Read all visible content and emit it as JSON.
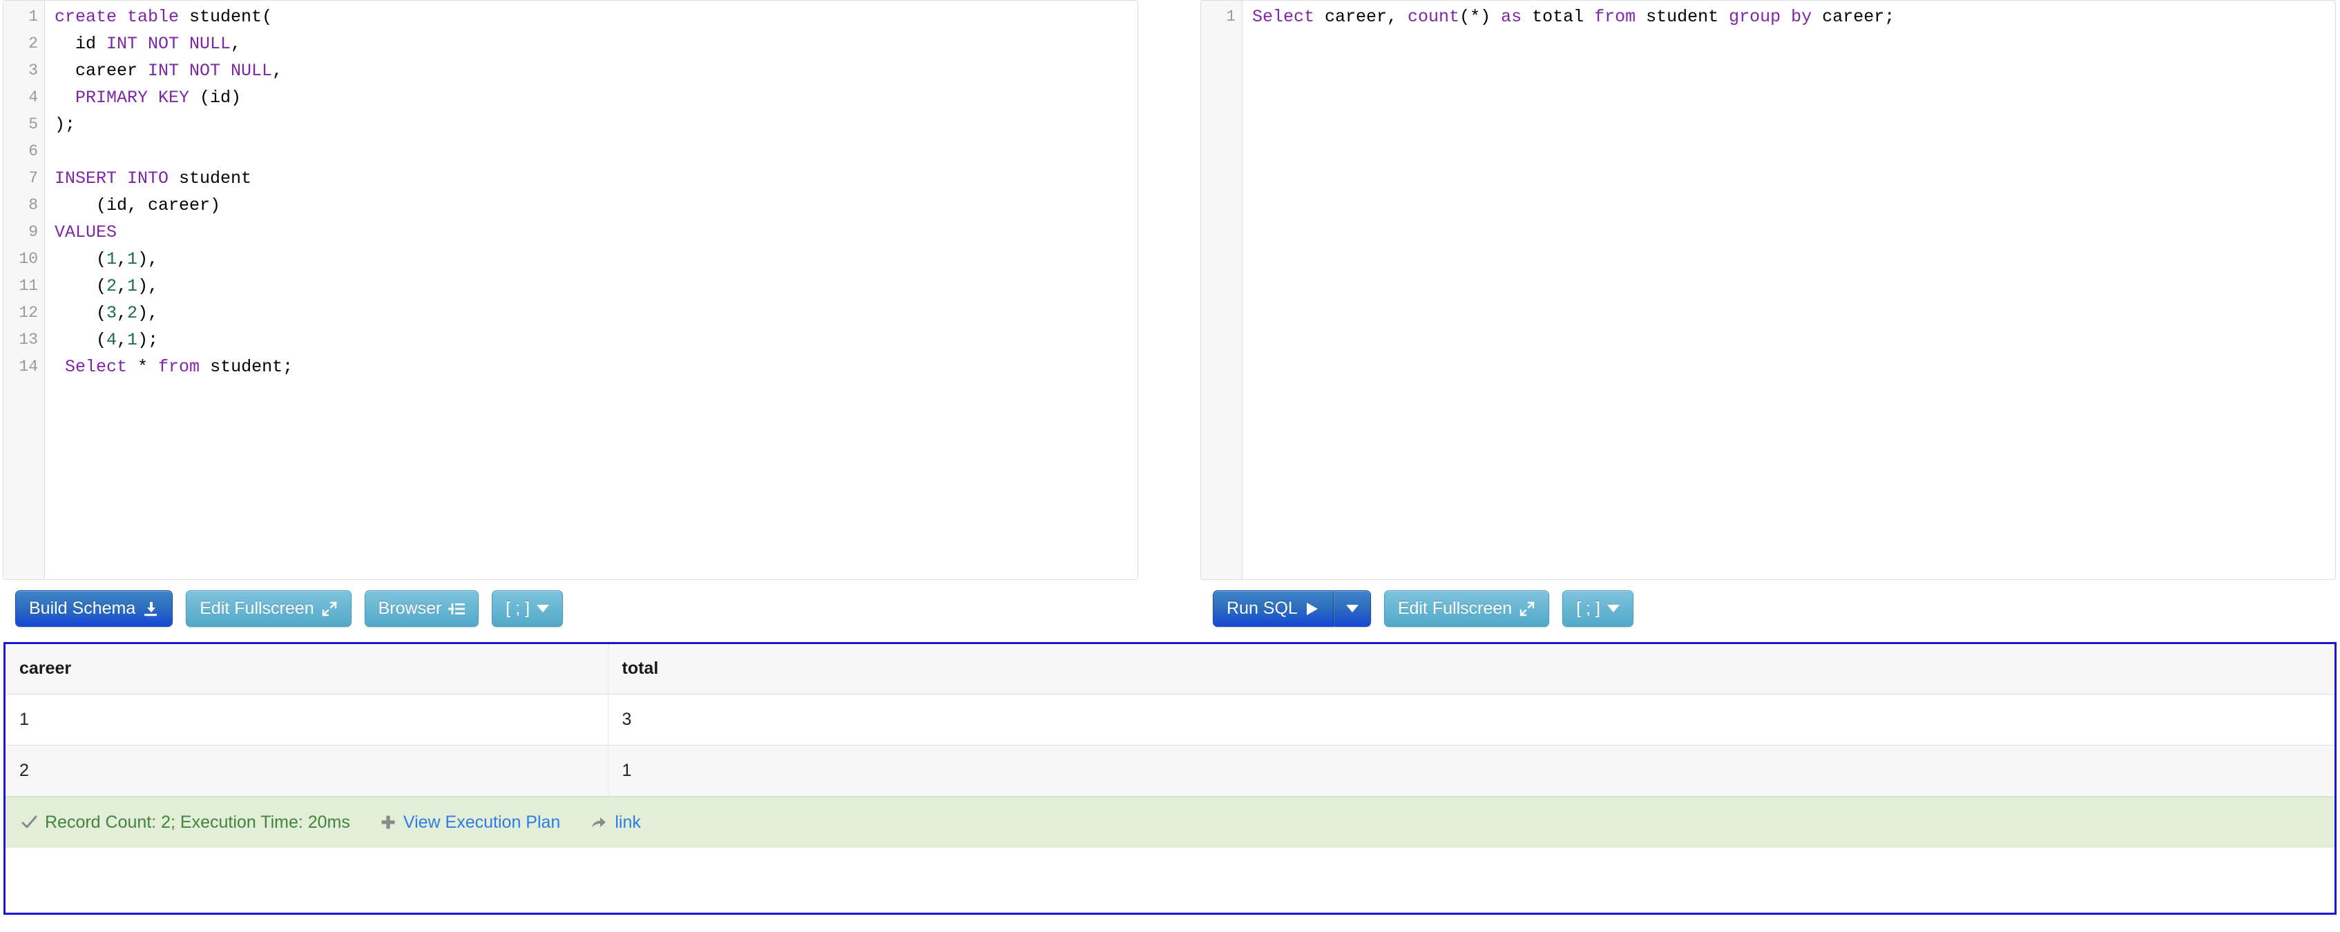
{
  "editors": {
    "left": {
      "name": "schema-sql-editor",
      "line_count": 14,
      "lines": [
        [
          {
            "t": "create table ",
            "c": "kw"
          },
          {
            "t": "student(",
            "c": "pl"
          }
        ],
        [
          {
            "t": "  id ",
            "c": "pl"
          },
          {
            "t": "INT NOT NULL",
            "c": "kw"
          },
          {
            "t": ",",
            "c": "pl"
          }
        ],
        [
          {
            "t": "  career ",
            "c": "pl"
          },
          {
            "t": "INT NOT NULL",
            "c": "kw"
          },
          {
            "t": ",",
            "c": "pl"
          }
        ],
        [
          {
            "t": "  ",
            "c": "pl"
          },
          {
            "t": "PRIMARY KEY",
            "c": "kw"
          },
          {
            "t": " (id)",
            "c": "pl"
          }
        ],
        [
          {
            "t": ");",
            "c": "pl"
          }
        ],
        [
          {
            "t": "",
            "c": "pl"
          }
        ],
        [
          {
            "t": "INSERT INTO ",
            "c": "kw"
          },
          {
            "t": "student",
            "c": "pl"
          }
        ],
        [
          {
            "t": "    (id, career)",
            "c": "pl"
          }
        ],
        [
          {
            "t": "VALUES",
            "c": "kw"
          }
        ],
        [
          {
            "t": "    (",
            "c": "pl"
          },
          {
            "t": "1",
            "c": "num"
          },
          {
            "t": ",",
            "c": "pl"
          },
          {
            "t": "1",
            "c": "num"
          },
          {
            "t": "),",
            "c": "pl"
          }
        ],
        [
          {
            "t": "    (",
            "c": "pl"
          },
          {
            "t": "2",
            "c": "num"
          },
          {
            "t": ",",
            "c": "pl"
          },
          {
            "t": "1",
            "c": "num"
          },
          {
            "t": "),",
            "c": "pl"
          }
        ],
        [
          {
            "t": "    (",
            "c": "pl"
          },
          {
            "t": "3",
            "c": "num"
          },
          {
            "t": ",",
            "c": "pl"
          },
          {
            "t": "2",
            "c": "num"
          },
          {
            "t": "),",
            "c": "pl"
          }
        ],
        [
          {
            "t": "    (",
            "c": "pl"
          },
          {
            "t": "4",
            "c": "num"
          },
          {
            "t": ",",
            "c": "pl"
          },
          {
            "t": "1",
            "c": "num"
          },
          {
            "t": ");",
            "c": "pl"
          }
        ],
        [
          {
            "t": " ",
            "c": "pl"
          },
          {
            "t": "Select",
            "c": "kw"
          },
          {
            "t": " * ",
            "c": "pl"
          },
          {
            "t": "from",
            "c": "kw"
          },
          {
            "t": " student;",
            "c": "pl"
          }
        ]
      ]
    },
    "right": {
      "name": "query-sql-editor",
      "line_count": 1,
      "lines": [
        [
          {
            "t": "Select",
            "c": "kw"
          },
          {
            "t": " career, ",
            "c": "pl"
          },
          {
            "t": "count",
            "c": "kw"
          },
          {
            "t": "(*) ",
            "c": "pl"
          },
          {
            "t": "as",
            "c": "kw"
          },
          {
            "t": " total ",
            "c": "pl"
          },
          {
            "t": "from",
            "c": "kw"
          },
          {
            "t": " student ",
            "c": "pl"
          },
          {
            "t": "group by",
            "c": "kw"
          },
          {
            "t": " career;",
            "c": "pl"
          }
        ]
      ]
    }
  },
  "toolbar_left": {
    "build_schema_label": "Build Schema",
    "build_schema_icon": "save-download-icon",
    "edit_fullscreen_label": "Edit Fullscreen",
    "edit_fullscreen_icon": "expand-diagonal-icon",
    "browser_label": "Browser",
    "browser_icon": "indent-list-icon",
    "delimiter_label": "[ ; ]",
    "delimiter_icon": "chevron-down-icon"
  },
  "toolbar_right": {
    "run_sql_label": "Run SQL",
    "run_sql_icon": "play-icon",
    "run_sql_caret_icon": "chevron-down-icon",
    "edit_fullscreen_label": "Edit Fullscreen",
    "edit_fullscreen_icon": "expand-diagonal-icon",
    "delimiter_label": "[ ; ]",
    "delimiter_icon": "chevron-down-icon"
  },
  "results": {
    "columns": [
      "career",
      "total"
    ],
    "rows": [
      [
        "1",
        "3"
      ],
      [
        "2",
        "1"
      ]
    ]
  },
  "status": {
    "check_icon": "checkmark-icon",
    "summary": "Record Count: 2; Execution Time: 20ms",
    "plus_icon": "plus-icon",
    "execution_plan_label": "View Execution Plan",
    "share_icon": "share-arrow-icon",
    "link_label": "link"
  },
  "colors": {
    "primary_button": "#1449d6",
    "info_button": "#52a8c9",
    "results_border": "#1a17d4",
    "status_bg": "#e2eed6",
    "status_text": "#41833f",
    "link": "#2d7de8",
    "keyword": "#7d26a8",
    "number": "#1a6b4a"
  }
}
